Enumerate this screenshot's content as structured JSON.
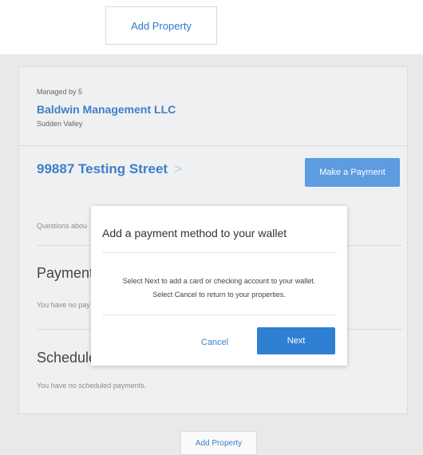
{
  "top_add_property_label": "Add Property",
  "property_card": {
    "managed_by": "Managed by 5",
    "company": "Baldwin Management LLC",
    "location": "Sudden Valley",
    "street": "99887 Testing Street",
    "chevron": ">",
    "make_payment_label": "Make a Payment",
    "questions_text": "Questions abou",
    "payments_heading": "Payment",
    "no_payments_text": "You have no pay",
    "scheduled_heading": "Schedule",
    "no_scheduled_text": "You have no scheduled payments."
  },
  "bottom_add_property_label": "Add Property",
  "modal": {
    "title": "Add a payment method to your wallet",
    "body_line1": "Select Next to add a card or checking account to your wallet.",
    "body_line2": "Select Cancel to return to your properties.",
    "cancel_label": "Cancel",
    "next_label": "Next"
  },
  "colors": {
    "accent": "#3f7fc9",
    "primary_button": "#2f7fd3",
    "make_payment_button": "#5d9ce0"
  }
}
